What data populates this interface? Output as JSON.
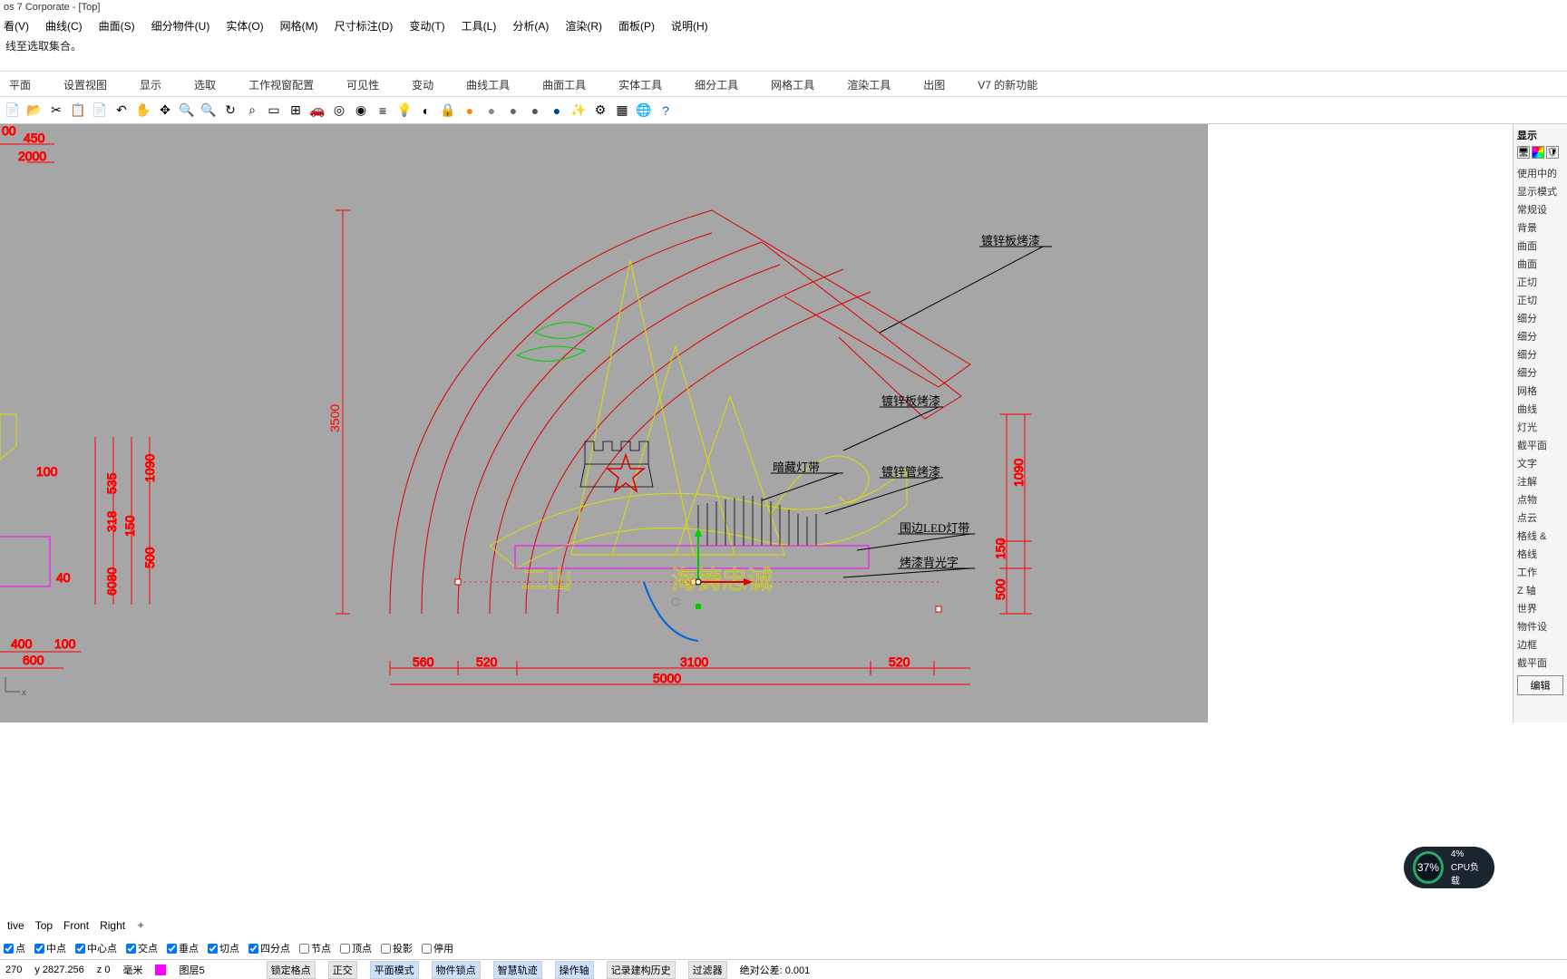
{
  "title_bar": "os 7 Corporate - [Top]",
  "menu": [
    "看(V)",
    "曲线(C)",
    "曲面(S)",
    "细分物件(U)",
    "实体(O)",
    "网格(M)",
    "尺寸标注(D)",
    "变动(T)",
    "工具(L)",
    "分析(A)",
    "渲染(R)",
    "面板(P)",
    "说明(H)"
  ],
  "cmd_history": "线至选取集合。",
  "tabs": [
    "平面",
    "设置视图",
    "显示",
    "选取",
    "工作视窗配置",
    "可见性",
    "变动",
    "曲线工具",
    "曲面工具",
    "实体工具",
    "细分工具",
    "网格工具",
    "渲染工具",
    "出图",
    "V7 的新功能"
  ],
  "right_panel": {
    "title": "显示",
    "sections": [
      "使用中的",
      "显示模式",
      "常规设",
      "背景",
      "曲面",
      "曲面",
      "正切",
      "正切",
      "细分",
      "细分",
      "细分",
      "细分",
      "网格",
      "曲线",
      "灯光",
      "截平面",
      "文字",
      "注解",
      "点物",
      "点云",
      "格线 &",
      "格线",
      "工作",
      "Z 轴",
      "世界",
      "物件设",
      "边框",
      "截平面"
    ],
    "button": "编辑"
  },
  "view_tabs": [
    "tive",
    "Top",
    "Front",
    "Right"
  ],
  "osnap": [
    {
      "label": "点",
      "checked": true
    },
    {
      "label": "中点",
      "checked": true
    },
    {
      "label": "中心点",
      "checked": true
    },
    {
      "label": "交点",
      "checked": true
    },
    {
      "label": "垂点",
      "checked": true
    },
    {
      "label": "切点",
      "checked": true
    },
    {
      "label": "四分点",
      "checked": true
    },
    {
      "label": "节点",
      "checked": false
    },
    {
      "label": "顶点",
      "checked": false
    },
    {
      "label": "投影",
      "checked": false
    },
    {
      "label": "停用",
      "checked": false
    }
  ],
  "status": {
    "coords": {
      "x": "270",
      "y": "y 2827.256",
      "z": "z 0"
    },
    "units": "毫米",
    "layer": "图层5",
    "tags": [
      "锁定格点",
      "正交",
      "平面模式",
      "物件锁点",
      "智慧轨迹",
      "操作轴",
      "记录建构历史",
      "过滤器"
    ],
    "tol": "绝对公差: 0.001"
  },
  "cpu": {
    "main": "37%",
    "sub": "4%",
    "label": "CPU负载"
  },
  "dims_left": {
    "d00": "00",
    "d450": "450",
    "d2000": "2000",
    "d100": "100",
    "d535": "535",
    "d318": "318",
    "d150": "150",
    "d1090": "1090",
    "d500": "500",
    "d40": "40",
    "d6080": "6080",
    "d400": "400",
    "d600": "600",
    "d100b": "100"
  },
  "dims_main": {
    "h3500": "3500",
    "w560": "560",
    "w520a": "520",
    "w3100": "3100",
    "w520b": "520",
    "w5000": "5000",
    "h1090": "1090",
    "h150": "150",
    "h500": "500"
  },
  "labels": {
    "l1": "镀锌板烤漆",
    "l2": "镀锌板烤漆",
    "l3": "暗藏灯带",
    "l4": "镀锌管烤漆",
    "l5": "围边LED灯带",
    "l6": "烤漆背光字"
  },
  "main_text": {
    "t1": "二山",
    "t2": "海铸忠诚"
  },
  "axis_label": "x"
}
